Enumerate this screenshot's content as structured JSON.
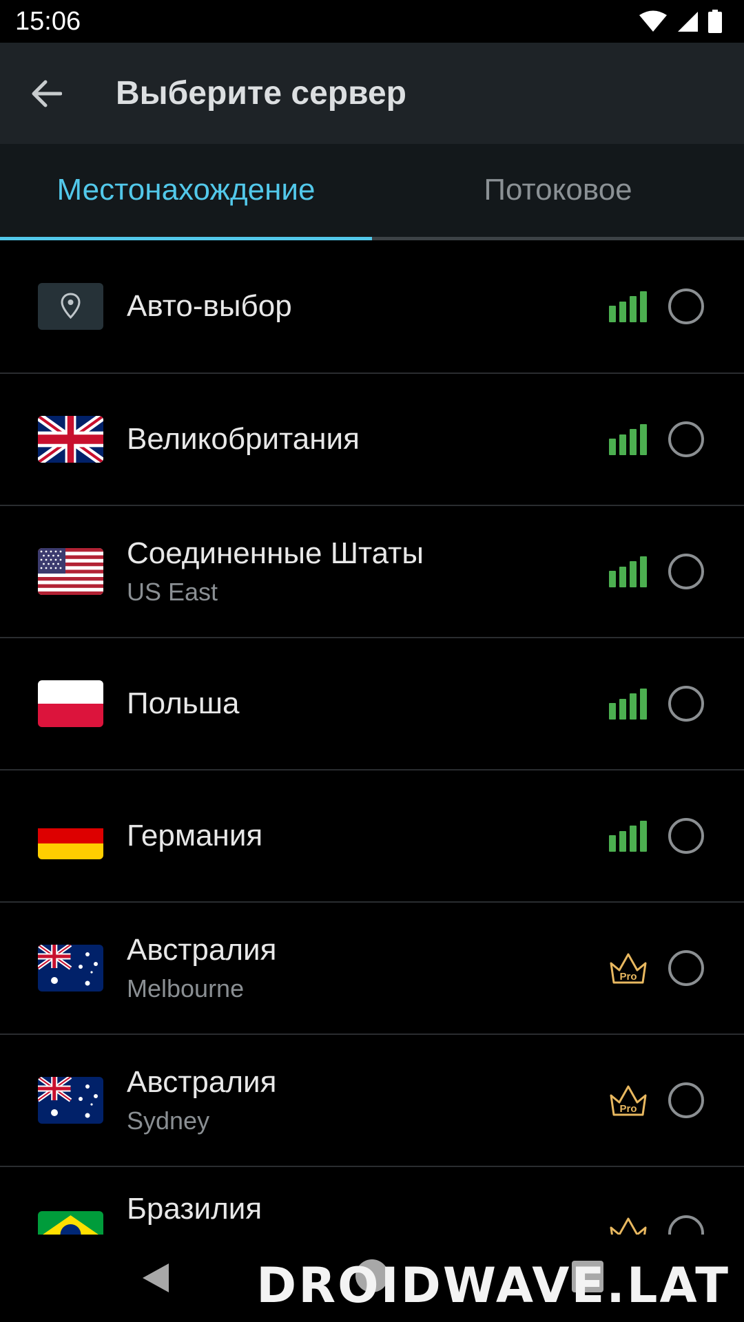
{
  "status_bar": {
    "time": "15:06"
  },
  "app_bar": {
    "title": "Выберите сервер"
  },
  "tabs": [
    {
      "label": "Местонахождение",
      "active": true
    },
    {
      "label": "Потоковое",
      "active": false
    }
  ],
  "servers": [
    {
      "name": "Авто-выбор",
      "sub": "",
      "flag": "location-pin",
      "indicator": "signal"
    },
    {
      "name": "Великобритания",
      "sub": "",
      "flag": "uk",
      "indicator": "signal"
    },
    {
      "name": "Соединенные Штаты",
      "sub": "US East",
      "flag": "us",
      "indicator": "signal"
    },
    {
      "name": "Польша",
      "sub": "",
      "flag": "poland",
      "indicator": "signal"
    },
    {
      "name": "Германия",
      "sub": "",
      "flag": "germany",
      "indicator": "signal"
    },
    {
      "name": "Австралия",
      "sub": "Melbourne",
      "flag": "australia",
      "indicator": "pro"
    },
    {
      "name": "Австралия",
      "sub": "Sydney",
      "flag": "australia",
      "indicator": "pro"
    },
    {
      "name": "Бразилия",
      "sub": "",
      "flag": "brazil",
      "indicator": "pro"
    }
  ],
  "pro_badge_text": "Pro",
  "watermark": "DROIDWAVE.LAT",
  "colors": {
    "accent": "#52c8ea",
    "signal": "#4caf50",
    "pro": "#e8b860",
    "appbar": "#1e2327",
    "background": "#000000"
  }
}
